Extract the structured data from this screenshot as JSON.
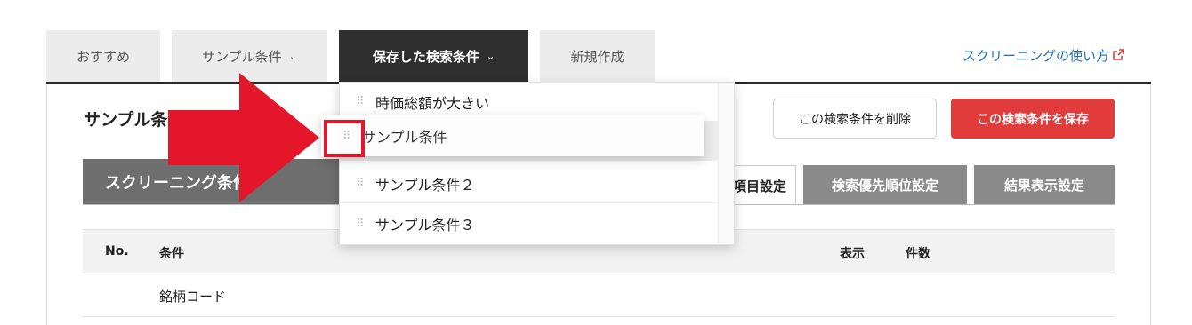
{
  "tabs": [
    {
      "label": "おすすめ",
      "chevron": ""
    },
    {
      "label": "サンプル条件",
      "chevron": "⌄"
    },
    {
      "label": "保存した検索条件",
      "chevron": "⌄"
    },
    {
      "label": "新規作成",
      "chevron": ""
    }
  ],
  "help_link": {
    "label": "スクリーニングの使い方",
    "icon": "external-link-icon"
  },
  "section": {
    "title": "サンプル条件"
  },
  "buttons": {
    "delete": "この検索条件を削除",
    "save": "この検索条件を保存"
  },
  "conditions_header": "スクリーニング条件",
  "subtabs": [
    "項目設定",
    "検索優先順位設定",
    "結果表示設定"
  ],
  "table": {
    "headers": {
      "no": "No.",
      "condition": "条件",
      "display": "表示",
      "count": "件数"
    },
    "rows": [
      {
        "no": "",
        "condition": "銘柄コード"
      }
    ]
  },
  "dropdown": {
    "items": [
      "時価総額が大きい",
      "サンプル条件",
      "サンプル条件２",
      "サンプル条件３"
    ],
    "dragging": "サンプル条件"
  },
  "colors": {
    "accent_red": "#e23b3b",
    "active_tab": "#2f2f2f",
    "link": "#1f6fb5",
    "annotation": "#e3162a"
  }
}
